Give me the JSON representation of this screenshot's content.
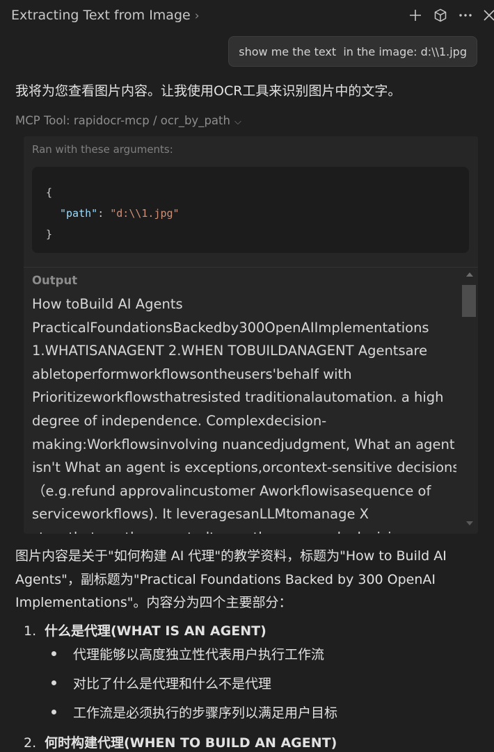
{
  "header": {
    "title": "Extracting Text from Image",
    "icons": [
      "chevron-right-icon",
      "plus-icon",
      "package-icon",
      "more-icon",
      "close-icon"
    ]
  },
  "user_message": "show me the text  in the image: d:\\\\1.jpg",
  "assistant_intro": "我将为您查看图片内容。让我使用OCR工具来识别图片中的文字。",
  "tool": {
    "prefix": "MCP Tool: ",
    "name": "rapidocr-mcp / ocr_by_path",
    "args_label": "Ran with these arguments:",
    "args_code": {
      "open": "{",
      "key": "\"path\"",
      "colon": ": ",
      "value": "\"d:\\\\1.jpg\"",
      "close": "}"
    },
    "output_label": "Output",
    "output_lines": [
      "How toBuild AI Agents",
      "PracticalFoundationsBackedby300OpenAIImplementations",
      "1.WHATISANAGENT 2.WHEN TOBUILDANAGENT Agentsare",
      "abletoperformworkflowsontheusers'behalf with",
      "Prioritizeworkflowsthatresisted traditionalautomation. a high",
      "degree of independence. Complexdecision-",
      "making:Workflowsinvolving nuancedjudgment, What an agent",
      "isn't What an agent is exceptions,orcontext-sensitive decisions",
      "（e.g.refund approvalincustomer Aworkflowisasequence of",
      "serviceworkflows). It leveragesanLLMtomanage X",
      "stepsthatmustbeexecutedtomeetheusersgoals.decision"
    ]
  },
  "summary": {
    "text": "图片内容是关于\"如何构建 AI 代理\"的教学资料，标题为\"How to Build AI Agents\"，副标题为\"Practical Foundations Backed by 300 OpenAI Implementations\"。内容分为四个主要部分：",
    "items": [
      {
        "number": "1.",
        "heading": "什么是代理(WHAT IS AN AGENT)",
        "bullets": [
          "代理能够以高度独立性代表用户执行工作流",
          "对比了什么是代理和什么不是代理",
          "工作流是必须执行的步骤序列以满足用户目标"
        ]
      },
      {
        "number": "2.",
        "heading": "何时构建代理(WHEN TO BUILD AN AGENT)",
        "bullets": []
      }
    ]
  },
  "colors": {
    "background": "#1f1f1f",
    "panel": "#262626",
    "code_background": "#1c1c1c",
    "json_key": "#9cdcfe",
    "json_string": "#ce9178"
  }
}
